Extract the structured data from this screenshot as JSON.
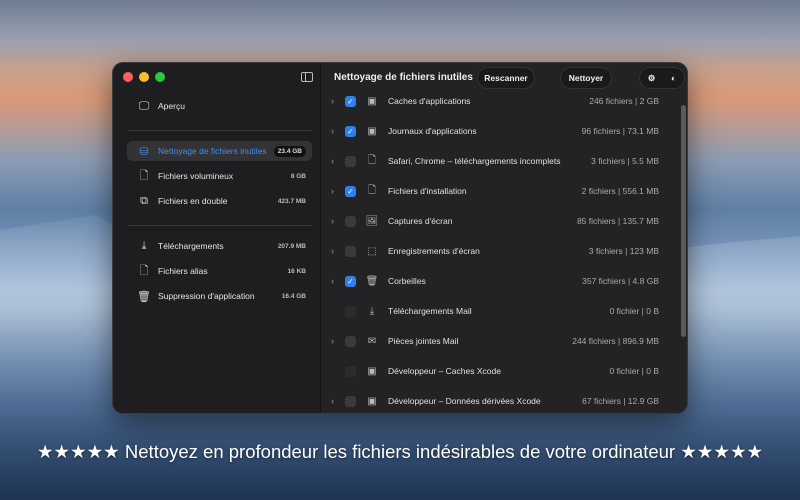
{
  "sidebar": {
    "items": [
      {
        "label": "Aperçu",
        "size": "",
        "icon": "monitor-icon"
      },
      {
        "label": "Nettoyage de fichiers inutiles",
        "size": "23.4 GB",
        "icon": "drive-icon"
      },
      {
        "label": "Fichiers volumineux",
        "size": "8 GB",
        "icon": "document-icon"
      },
      {
        "label": "Fichiers en double",
        "size": "423.7 MB",
        "icon": "duplicate-icon"
      },
      {
        "label": "Téléchargements",
        "size": "207.9 MB",
        "icon": "download-icon"
      },
      {
        "label": "Fichiers alias",
        "size": "16 KB",
        "icon": "alias-icon"
      },
      {
        "label": "Suppression d'application",
        "size": "16.4 GB",
        "icon": "trash-icon"
      }
    ]
  },
  "header": {
    "title": "Nettoyage de fichiers inutiles",
    "rescan": "Rescanner",
    "clean": "Nettoyer"
  },
  "rows": [
    {
      "label": "Caches d'applications",
      "value": "246 fichiers | 2 GB",
      "checked": true,
      "expandable": true
    },
    {
      "label": "Journaux d'applications",
      "value": "96 fichiers | 73.1 MB",
      "checked": true,
      "expandable": true
    },
    {
      "label": "Safari, Chrome – téléchargements incomplets",
      "value": "3 fichiers | 5.5 MB",
      "checked": false,
      "expandable": true
    },
    {
      "label": "Fichiers d'installation",
      "value": "2 fichiers | 556.1 MB",
      "checked": true,
      "expandable": true
    },
    {
      "label": "Captures d'écran",
      "value": "85 fichiers | 135.7 MB",
      "checked": false,
      "expandable": true
    },
    {
      "label": "Enregistrements d'écran",
      "value": "3 fichiers | 123 MB",
      "checked": false,
      "expandable": true
    },
    {
      "label": "Corbeilles",
      "value": "357 fichiers | 4.8 GB",
      "checked": true,
      "expandable": true
    },
    {
      "label": "Téléchargements Mail",
      "value": "0 fichier | 0 B",
      "checked": false,
      "expandable": false
    },
    {
      "label": "Pièces jointes Mail",
      "value": "244 fichiers | 896.9 MB",
      "checked": false,
      "expandable": true
    },
    {
      "label": "Développeur – Caches Xcode",
      "value": "0 fichier | 0 B",
      "checked": false,
      "expandable": false
    },
    {
      "label": "Développeur – Données dérivées Xcode",
      "value": "67 fichiers | 12.9 GB",
      "checked": false,
      "expandable": true
    }
  ],
  "caption": "★★★★★ Nettoyez en profondeur les fichiers indésirables de votre ordinateur ★★★★★",
  "colors": {
    "accent": "#2f80ed"
  }
}
